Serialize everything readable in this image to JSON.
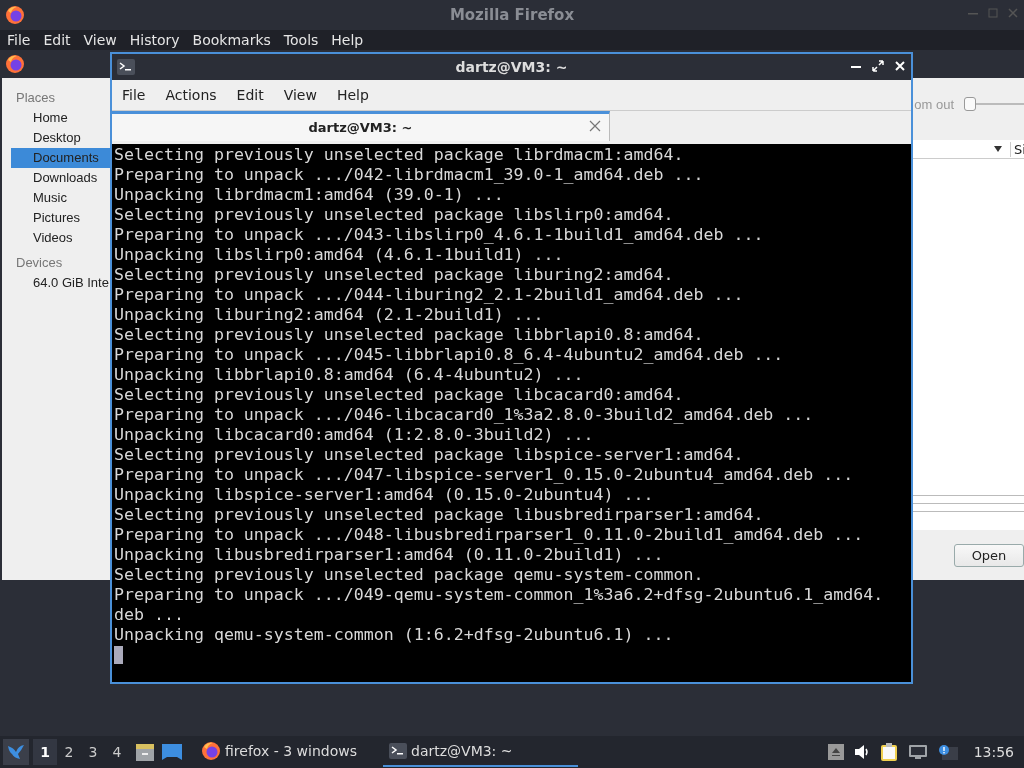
{
  "firefox_window": {
    "title": "Mozilla Firefox",
    "menu": [
      "File",
      "Edit",
      "View",
      "History",
      "Bookmarks",
      "Tools",
      "Help"
    ]
  },
  "file_dialog": {
    "places_heading": "Places",
    "places": [
      {
        "label": "Home",
        "selected": false
      },
      {
        "label": "Desktop",
        "selected": false
      },
      {
        "label": "Documents",
        "selected": true
      },
      {
        "label": "Downloads",
        "selected": false
      },
      {
        "label": "Music",
        "selected": false
      },
      {
        "label": "Pictures",
        "selected": false
      },
      {
        "label": "Videos",
        "selected": false
      }
    ],
    "devices_heading": "Devices",
    "devices": [
      "64.0 GiB Inte"
    ],
    "zoom_label": "om out",
    "zoom": {
      "level": 0
    },
    "column_header": "Si",
    "open_button": "Open"
  },
  "terminal": {
    "title": "dartz@VM3: ~",
    "menu": [
      "File",
      "Actions",
      "Edit",
      "View",
      "Help"
    ],
    "tabs": [
      {
        "label": "dartz@VM3: ~",
        "selected": true
      }
    ],
    "lines": [
      "Selecting previously unselected package librdmacm1:amd64.",
      "Preparing to unpack .../042-librdmacm1_39.0-1_amd64.deb ...",
      "Unpacking librdmacm1:amd64 (39.0-1) ...",
      "Selecting previously unselected package libslirp0:amd64.",
      "Preparing to unpack .../043-libslirp0_4.6.1-1build1_amd64.deb ...",
      "Unpacking libslirp0:amd64 (4.6.1-1build1) ...",
      "Selecting previously unselected package liburing2:amd64.",
      "Preparing to unpack .../044-liburing2_2.1-2build1_amd64.deb ...",
      "Unpacking liburing2:amd64 (2.1-2build1) ...",
      "Selecting previously unselected package libbrlapi0.8:amd64.",
      "Preparing to unpack .../045-libbrlapi0.8_6.4-4ubuntu2_amd64.deb ...",
      "Unpacking libbrlapi0.8:amd64 (6.4-4ubuntu2) ...",
      "Selecting previously unselected package libcacard0:amd64.",
      "Preparing to unpack .../046-libcacard0_1%3a2.8.0-3build2_amd64.deb ...",
      "Unpacking libcacard0:amd64 (1:2.8.0-3build2) ...",
      "Selecting previously unselected package libspice-server1:amd64.",
      "Preparing to unpack .../047-libspice-server1_0.15.0-2ubuntu4_amd64.deb ...",
      "Unpacking libspice-server1:amd64 (0.15.0-2ubuntu4) ...",
      "Selecting previously unselected package libusbredirparser1:amd64.",
      "Preparing to unpack .../048-libusbredirparser1_0.11.0-2build1_amd64.deb ...",
      "Unpacking libusbredirparser1:amd64 (0.11.0-2build1) ...",
      "Selecting previously unselected package qemu-system-common.",
      "Preparing to unpack .../049-qemu-system-common_1%3a6.2+dfsg-2ubuntu6.1_amd64.",
      "deb ...",
      "Unpacking qemu-system-common (1:6.2+dfsg-2ubuntu6.1) ..."
    ]
  },
  "taskbar": {
    "workspaces": [
      {
        "label": "1",
        "selected": true
      },
      {
        "label": "2",
        "selected": false
      },
      {
        "label": "3",
        "selected": false
      },
      {
        "label": "4",
        "selected": false
      }
    ],
    "tasks": [
      {
        "kind": "browser",
        "label": "firefox - 3 windows",
        "selected": false
      },
      {
        "kind": "terminal",
        "label": "dartz@VM3: ~",
        "selected": true
      }
    ],
    "clock": "13:56"
  }
}
